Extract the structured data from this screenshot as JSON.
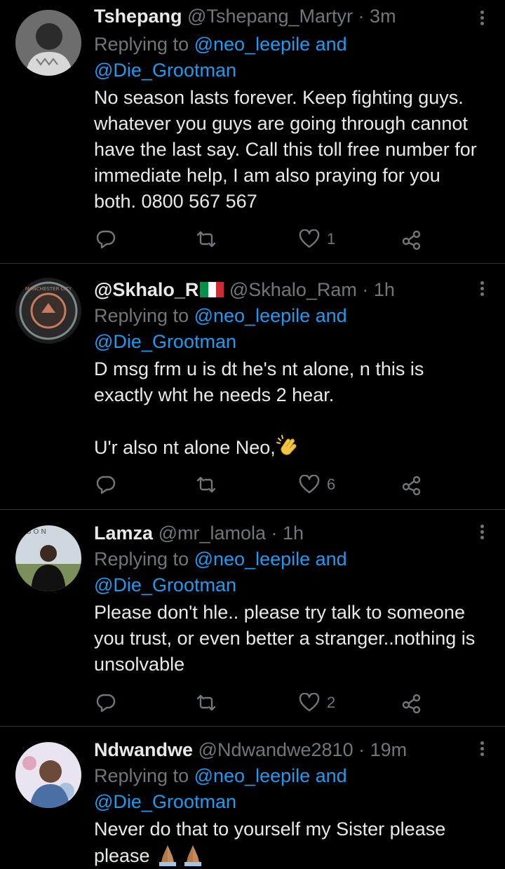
{
  "tweets": [
    {
      "name": "Tshepang",
      "handle": "@Tshepang_Martyr",
      "time": "3m",
      "replying_prefix": "Replying to ",
      "mention1": "@neo_leepile",
      "and": " and",
      "mention2": "@Die_Grootman",
      "text": "No season lasts forever. Keep fighting guys. whatever you guys are going through cannot have the last say. Call this toll free number for immediate help, I am also praying for you both. 0800 567 567",
      "likes": "1"
    },
    {
      "name": "@Skhalo_R",
      "handle": "@Skhalo_Ram",
      "time": "1h",
      "replying_prefix": "Replying to ",
      "mention1": "@neo_leepile",
      "and": " and",
      "mention2": "@Die_Grootman",
      "text": "D msg frm u is dt he's nt alone, n this is exactly wht he needs 2 hear.\n\nU'r also nt alone Neo,",
      "likes": "6",
      "avatar_text": "MANCHESTER CITY"
    },
    {
      "name": "Lamza",
      "handle": "@mr_lamola",
      "time": "1h",
      "replying_prefix": "Replying to ",
      "mention1": "@neo_leepile",
      "and": " and",
      "mention2": "@Die_Grootman",
      "text": "Please don't hle.. please try talk to someone you trust, or even better a stranger..nothing is unsolvable",
      "likes": "2",
      "avatar_text": "ABON"
    },
    {
      "name": "Ndwandwe",
      "handle": "@Ndwandwe2810",
      "time": "19m",
      "replying_prefix": "Replying to ",
      "mention1": "@neo_leepile",
      "and": " and",
      "mention2": "@Die_Grootman",
      "text": "Never do that to yourself my Sister please please",
      "likes": ""
    }
  ],
  "separator": " · ",
  "colors": {
    "background": "#000000",
    "mention": "#1d9bf0",
    "muted": "#71767b",
    "text": "#e7e9ea",
    "divider": "#2f3336"
  },
  "icons": [
    "reply-icon",
    "retweet-icon",
    "like-icon",
    "share-icon",
    "more-options-icon"
  ]
}
